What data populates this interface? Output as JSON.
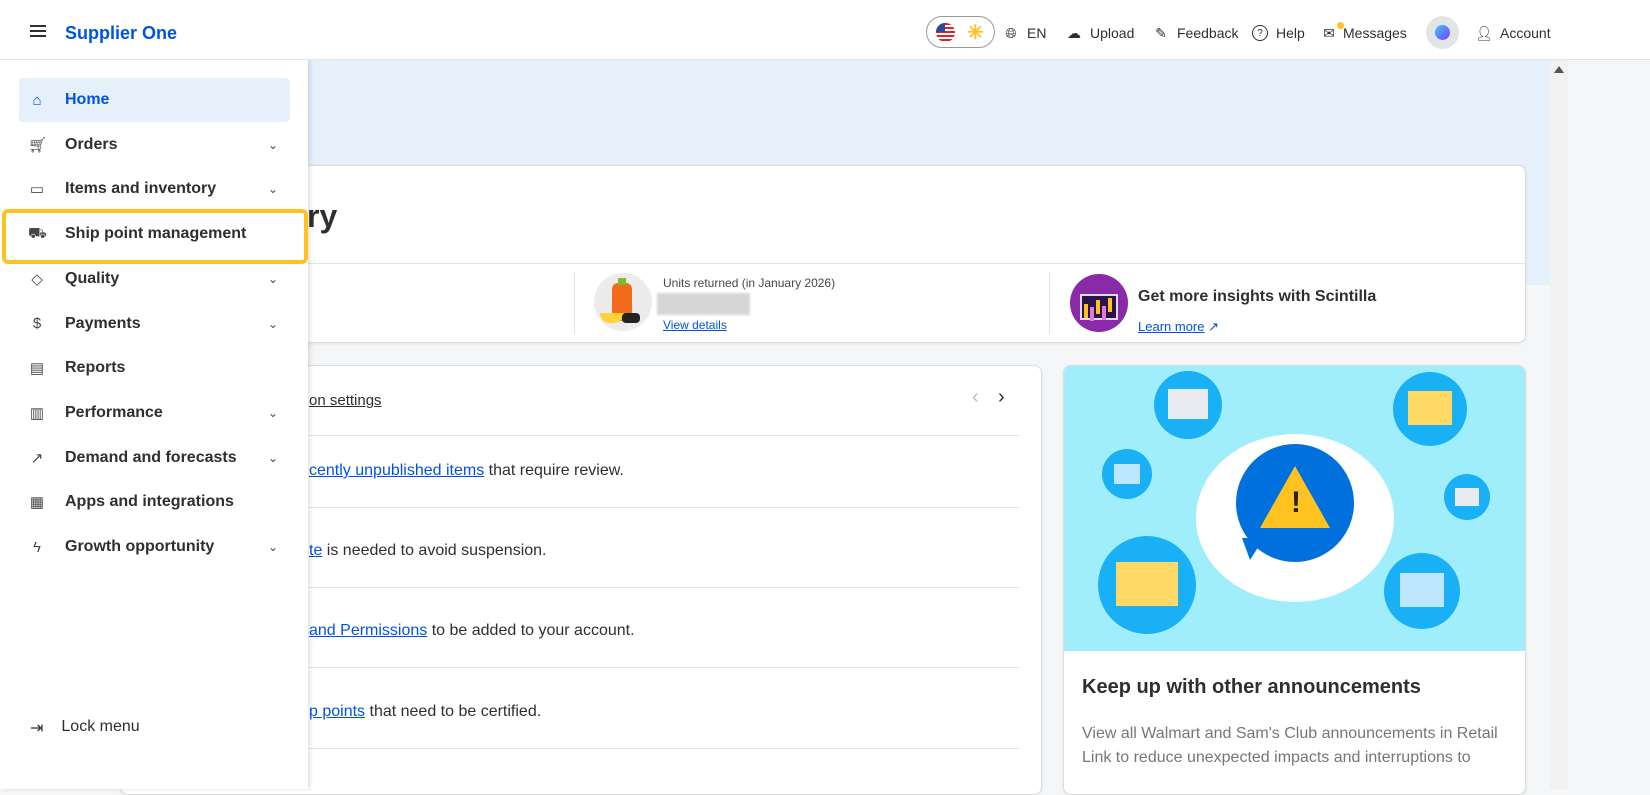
{
  "header": {
    "brand": "Supplier One",
    "language": "EN",
    "upload": "Upload",
    "feedback": "Feedback",
    "help": "Help",
    "messages": "Messages",
    "account": "Account"
  },
  "sidebar": {
    "items": [
      {
        "label": "Home",
        "icon": "home-icon",
        "chevron": false,
        "active": true
      },
      {
        "label": "Orders",
        "icon": "cart-icon",
        "chevron": true
      },
      {
        "label": "Items and inventory",
        "icon": "box-icon",
        "chevron": true
      },
      {
        "label": "Ship point management",
        "icon": "truck-icon",
        "chevron": false
      },
      {
        "label": "Quality",
        "icon": "diamond-icon",
        "chevron": true
      },
      {
        "label": "Payments",
        "icon": "dollar-icon",
        "chevron": true
      },
      {
        "label": "Reports",
        "icon": "clipboard-icon",
        "chevron": false
      },
      {
        "label": "Performance",
        "icon": "bar-chart-icon",
        "chevron": true
      },
      {
        "label": "Demand and forecasts",
        "icon": "trend-icon",
        "chevron": true
      },
      {
        "label": "Apps and integrations",
        "icon": "store-icon",
        "chevron": false
      },
      {
        "label": "Growth opportunity",
        "icon": "bolt-icon",
        "chevron": true
      }
    ],
    "lock_menu": "Lock menu"
  },
  "summary": {
    "title_fragment": "ry",
    "units_returned_label": "Units returned (in January 2026)",
    "view_details": "View details",
    "scintilla_title": "Get more insights with Scintilla",
    "learn_more": "Learn more"
  },
  "tasks": {
    "settings_link": "on settings",
    "rows": [
      {
        "link": "cently unpublished items",
        "text": " that require review."
      },
      {
        "link": "te",
        "text": " is needed to avoid suspension."
      },
      {
        "link": "and Permissions",
        "text": " to be added to your account."
      },
      {
        "link": "p points",
        "text": " that need to be certified."
      }
    ]
  },
  "announcement": {
    "title": "Keep up with other announcements",
    "body": "View all Walmart and Sam's Club announcements in Retail Link to reduce unexpected impacts and interruptions to"
  }
}
